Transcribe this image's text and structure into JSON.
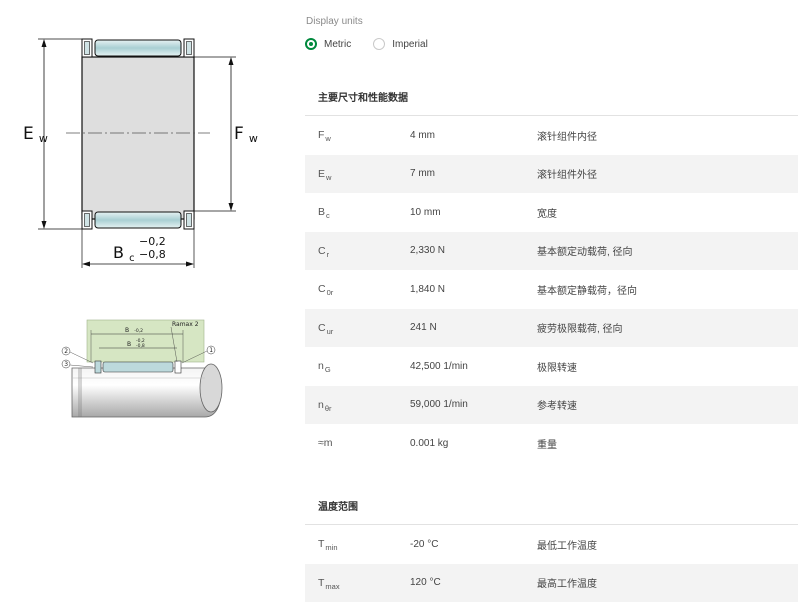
{
  "drawing_labels": {
    "ew_main": "E",
    "ew_sub": "w",
    "fw_main": "F",
    "fw_sub": "w",
    "bc_main": "B",
    "bc_sub": "c",
    "bc_tol_upper": "−0,2",
    "bc_tol_lower": "−0,8"
  },
  "mount_labels": {
    "bc_wide": "B",
    "bc_wide_tol": "-0,2",
    "bc_inner": "B",
    "bc_inner_tol_upper": "-0,2",
    "bc_inner_tol_lower": "-0,8",
    "ramax": "Ramax 2",
    "callout_1": "1",
    "callout_2": "2",
    "callout_3": "3"
  },
  "display_units": {
    "label": "Display units",
    "options": [
      {
        "label": "Metric",
        "selected": true
      },
      {
        "label": "Imperial",
        "selected": false
      }
    ]
  },
  "dimensions": {
    "title": "主要尺寸和性能数据",
    "rows": [
      {
        "sym": "F",
        "sub": "w",
        "value": "4 mm",
        "desc": "滚针组件内径"
      },
      {
        "sym": "E",
        "sub": "w",
        "value": "7 mm",
        "desc": "滚针组件外径"
      },
      {
        "sym": "B",
        "sub": "c",
        "value": "10 mm",
        "desc": "宽度"
      },
      {
        "sym": "C",
        "sub": "r",
        "value": "2,330 N",
        "desc": "基本额定动载荷, 径向"
      },
      {
        "sym": "C",
        "sub": "0r",
        "value": "1,840 N",
        "desc": "基本额定静载荷，径向"
      },
      {
        "sym": "C",
        "sub": "ur",
        "value": "241 N",
        "desc": "疲劳极限载荷, 径向"
      },
      {
        "sym": "n",
        "sub": "G",
        "value": "42,500 1/min",
        "desc": "极限转速"
      },
      {
        "sym": "n",
        "sub": "θr",
        "value": "59,000 1/min",
        "desc": "参考转速"
      },
      {
        "sym": "≈m",
        "sub": "",
        "value": "0.001 kg",
        "desc": "重量"
      }
    ]
  },
  "temperature": {
    "title": "温度范围",
    "rows": [
      {
        "sym": "T",
        "sub": "min",
        "value": "-20 °C",
        "desc": "最低工作温度"
      },
      {
        "sym": "T",
        "sub": "max",
        "value": "120 °C",
        "desc": "最高工作温度"
      }
    ]
  },
  "colors": {
    "accent": "#00893d",
    "row_alt": "#f3f3f3",
    "roller": "#bcd9dc",
    "housing_fill": "#e0e0e0",
    "mount_green": "#d6e6c3"
  }
}
